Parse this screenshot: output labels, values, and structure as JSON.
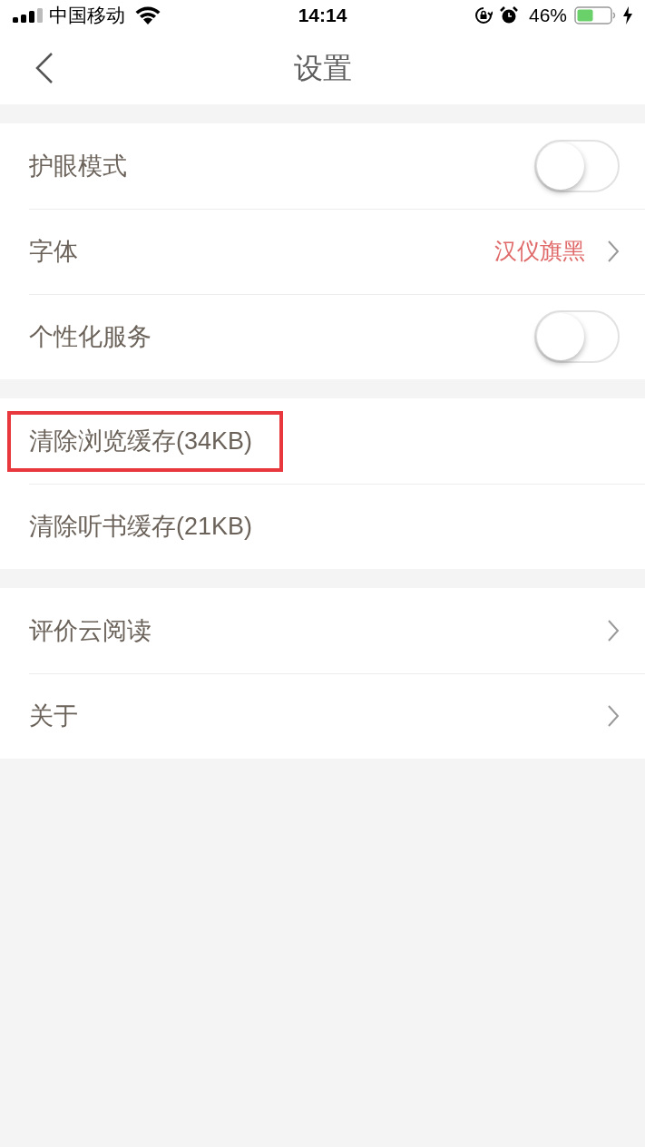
{
  "status_bar": {
    "carrier": "中国移动",
    "time": "14:14",
    "battery": "46%"
  },
  "nav": {
    "title": "设置"
  },
  "groups": [
    {
      "items": [
        {
          "kind": "toggle",
          "label": "护眼模式",
          "on": false
        },
        {
          "kind": "value",
          "label": "字体",
          "value": "汉仪旗黑"
        },
        {
          "kind": "toggle",
          "label": "个性化服务",
          "on": false
        }
      ]
    },
    {
      "items": [
        {
          "kind": "action",
          "label": "清除浏览缓存(34KB)",
          "highlighted": true
        },
        {
          "kind": "action",
          "label": "清除听书缓存(21KB)",
          "highlighted": false
        }
      ]
    },
    {
      "items": [
        {
          "kind": "link",
          "label": "评价云阅读"
        },
        {
          "kind": "link",
          "label": "关于"
        }
      ]
    }
  ]
}
